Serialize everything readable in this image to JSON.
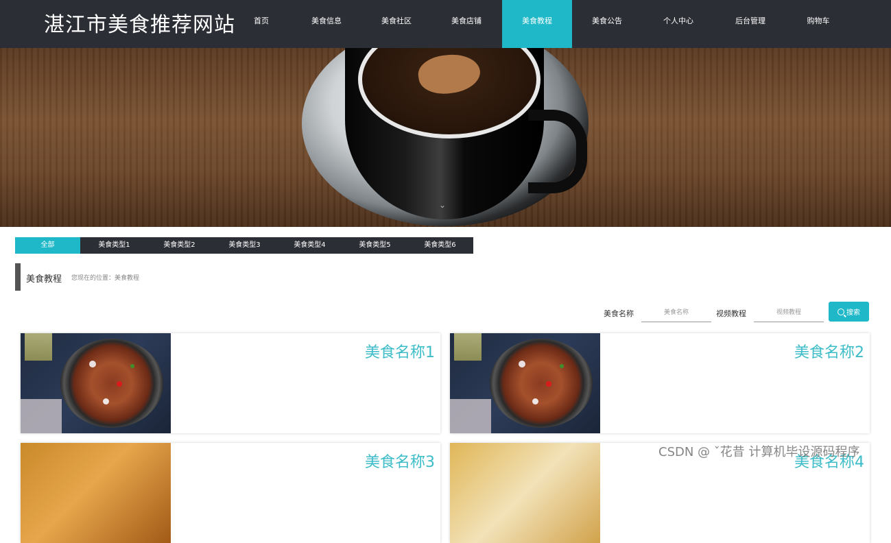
{
  "site": {
    "title": "湛江市美食推荐网站"
  },
  "nav": {
    "items": [
      "首页",
      "美食信息",
      "美食社区",
      "美食店铺",
      "美食教程",
      "美食公告",
      "个人中心",
      "后台管理",
      "购物车"
    ],
    "active_index": 4
  },
  "categories": {
    "items": [
      "全部",
      "美食类型1",
      "美食类型2",
      "美食类型3",
      "美食类型4",
      "美食类型5",
      "美食类型6"
    ],
    "active_index": 0
  },
  "section": {
    "title": "美食教程",
    "breadcrumb": "您现在的位置：美食教程"
  },
  "search": {
    "name_label": "美食名称",
    "name_placeholder": "美食名称",
    "video_label": "视频教程",
    "video_placeholder": "视频教程",
    "button_label": "搜索"
  },
  "cards": [
    {
      "name": "美食名称1"
    },
    {
      "name": "美食名称2"
    },
    {
      "name": "美食名称3"
    },
    {
      "name": "美食名称4"
    }
  ],
  "watermark": "CSDN @ ˇ花昔  计算机毕设源码程序",
  "colors": {
    "accent": "#1eb8c9",
    "header_bg": "#2c2e35",
    "card_title": "#3bbcc8"
  }
}
